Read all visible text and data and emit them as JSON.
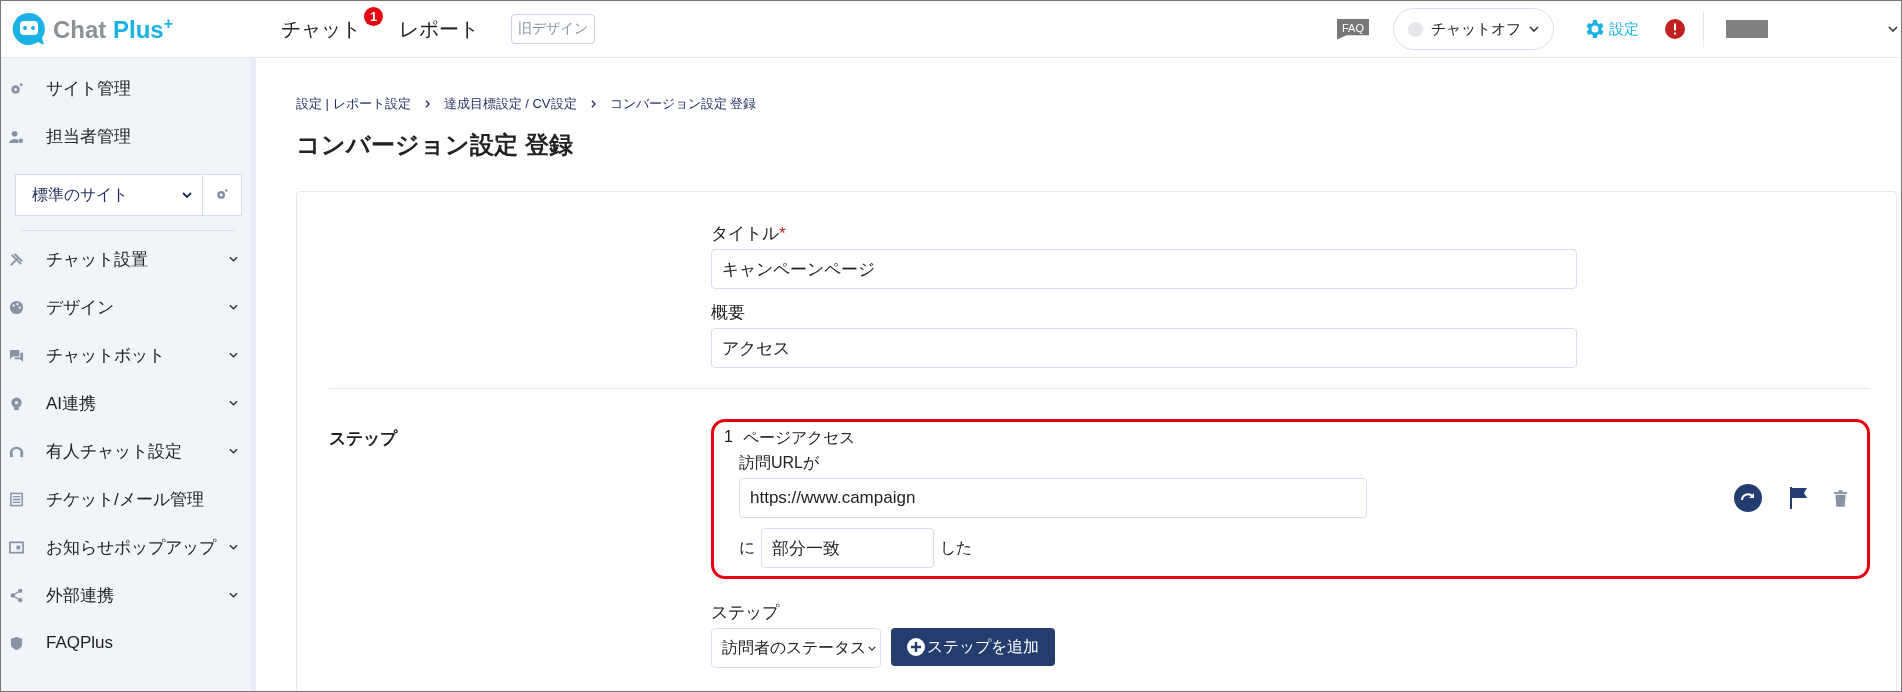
{
  "header": {
    "logo": {
      "name": "Chat ",
      "accent": "Plus",
      "mark": "+"
    },
    "nav": [
      {
        "label": "チャット",
        "badge": "1"
      },
      {
        "label": "レポート"
      }
    ],
    "old_design_button": "旧デザイン",
    "faq": "FAQ",
    "status": {
      "label": "チャットオフ",
      "online": false
    },
    "settings": "設定"
  },
  "sidebar": {
    "top_items": [
      {
        "label": "サイト管理"
      },
      {
        "label": "担当者管理"
      }
    ],
    "site_select": "標準のサイト",
    "items": [
      {
        "label": "チャット設置",
        "expandable": true
      },
      {
        "label": "デザイン",
        "expandable": true
      },
      {
        "label": "チャットボット",
        "expandable": true
      },
      {
        "label": "AI連携",
        "expandable": true
      },
      {
        "label": "有人チャット設定",
        "expandable": true
      },
      {
        "label": "チケット/メール管理",
        "expandable": false
      },
      {
        "label": "お知らせポップアップ",
        "expandable": true
      },
      {
        "label": "外部連携",
        "expandable": true
      },
      {
        "label": "FAQPlus",
        "expandable": false
      }
    ]
  },
  "breadcrumb": [
    "設定 | レポート設定",
    "達成目標設定 / CV設定",
    "コンバージョン設定 登録"
  ],
  "page_title": "コンバージョン設定 登録",
  "form": {
    "fields": [
      {
        "label": "タイトル",
        "required_mark": "*",
        "value": "キャンペーンページ"
      },
      {
        "label": "概要",
        "value": "アクセス"
      }
    ],
    "steps_label": "ステップ",
    "steps": [
      {
        "number": "1",
        "title": "ページアクセス",
        "condition_label": "訪問URLが",
        "url": "https://www.campaign",
        "particle": "に",
        "match": "部分一致",
        "suffix": "した"
      }
    ],
    "add_step": {
      "label": "ステップ",
      "select": "訪問者のステータス",
      "button": "ステップを追加"
    }
  }
}
